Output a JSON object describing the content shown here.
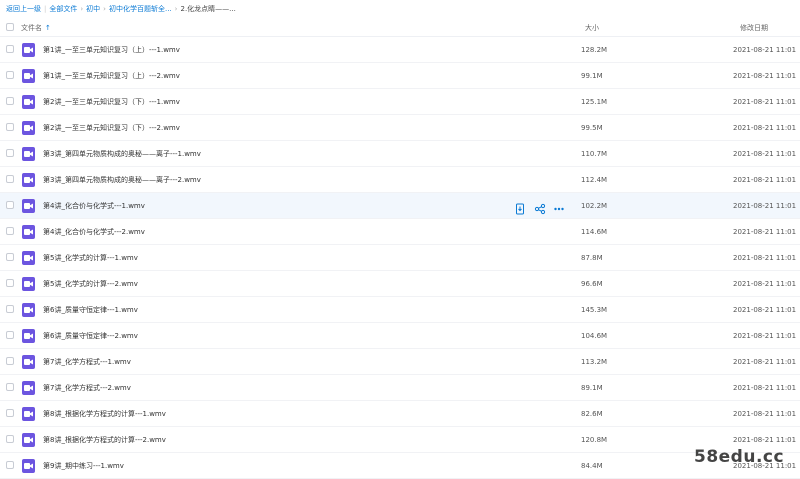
{
  "breadcrumb": {
    "back_label": "返回上一级",
    "items": [
      "全部文件",
      "初中",
      "初中化学百题斩全...",
      "2.化龙点睛——..."
    ]
  },
  "header": {
    "name_label": "文件名",
    "size_label": "大小",
    "date_label": "修改日期"
  },
  "files": [
    {
      "name": "第1讲_一至三单元知识复习（上）---1.wmv",
      "size": "128.2M",
      "date": "2021-08-21 11:01"
    },
    {
      "name": "第1讲_一至三单元知识复习（上）---2.wmv",
      "size": "99.1M",
      "date": "2021-08-21 11:01"
    },
    {
      "name": "第2讲_一至三单元知识复习（下）---1.wmv",
      "size": "125.1M",
      "date": "2021-08-21 11:01"
    },
    {
      "name": "第2讲_一至三单元知识复习（下）---2.wmv",
      "size": "99.5M",
      "date": "2021-08-21 11:01"
    },
    {
      "name": "第3讲_第四单元物质构成的奥秘——离子---1.wmv",
      "size": "110.7M",
      "date": "2021-08-21 11:01"
    },
    {
      "name": "第3讲_第四单元物质构成的奥秘——离子---2.wmv",
      "size": "112.4M",
      "date": "2021-08-21 11:01"
    },
    {
      "name": "第4讲_化合价与化学式---1.wmv",
      "size": "102.2M",
      "date": "2021-08-21 11:01"
    },
    {
      "name": "第4讲_化合价与化学式---2.wmv",
      "size": "114.6M",
      "date": "2021-08-21 11:01"
    },
    {
      "name": "第5讲_化学式的计算---1.wmv",
      "size": "87.8M",
      "date": "2021-08-21 11:01"
    },
    {
      "name": "第5讲_化学式的计算---2.wmv",
      "size": "96.6M",
      "date": "2021-08-21 11:01"
    },
    {
      "name": "第6讲_质量守恒定律---1.wmv",
      "size": "145.3M",
      "date": "2021-08-21 11:01"
    },
    {
      "name": "第6讲_质量守恒定律---2.wmv",
      "size": "104.6M",
      "date": "2021-08-21 11:01"
    },
    {
      "name": "第7讲_化学方程式---1.wmv",
      "size": "113.2M",
      "date": "2021-08-21 11:01"
    },
    {
      "name": "第7讲_化学方程式---2.wmv",
      "size": "89.1M",
      "date": "2021-08-21 11:01"
    },
    {
      "name": "第8讲_根据化学方程式的计算---1.wmv",
      "size": "82.6M",
      "date": "2021-08-21 11:01"
    },
    {
      "name": "第8讲_根据化学方程式的计算---2.wmv",
      "size": "120.8M",
      "date": "2021-08-21 11:01"
    },
    {
      "name": "第9讲_期中练习---1.wmv",
      "size": "84.4M",
      "date": "2021-08-21 11:01"
    }
  ],
  "hovered_row": 6,
  "row_actions": [
    "download-icon",
    "share-icon",
    "more-icon"
  ],
  "watermark": "58edu.cc",
  "colors": {
    "accent": "#0b7ad4",
    "video_icon": "#6c55e0",
    "hover_bg": "#f2f7fd"
  }
}
